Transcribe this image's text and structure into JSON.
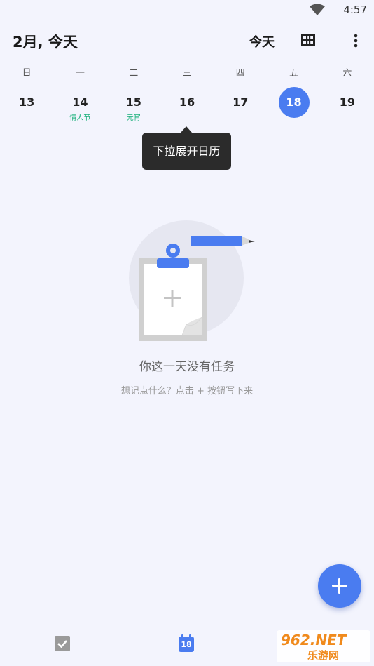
{
  "status_bar": {
    "time": "4:57",
    "wifi_icon": "wifi-icon"
  },
  "header": {
    "title": "2月, 今天",
    "today_label": "今天",
    "view_icon": "calendar-view-icon",
    "more_icon": "more-vert-icon"
  },
  "week": {
    "weekdays": [
      "日",
      "一",
      "二",
      "三",
      "四",
      "五",
      "六"
    ],
    "dates": [
      {
        "day": "13",
        "festival": ""
      },
      {
        "day": "14",
        "festival": "情人节"
      },
      {
        "day": "15",
        "festival": "元宵"
      },
      {
        "day": "16",
        "festival": ""
      },
      {
        "day": "17",
        "festival": ""
      },
      {
        "day": "18",
        "festival": ""
      },
      {
        "day": "19",
        "festival": ""
      }
    ],
    "selected_index": 5
  },
  "tooltip": {
    "text": "下拉展开日历"
  },
  "empty_state": {
    "title": "你这一天没有任务",
    "hint": "想记点什么？点击 + 按钮写下来",
    "illustration_icon": "clipboard-pencil-illustration"
  },
  "fab": {
    "icon": "plus-icon"
  },
  "bottom_nav": {
    "tasks_icon": "checkbox-icon",
    "calendar_icon": "calendar-icon",
    "calendar_day": "18"
  },
  "watermark": {
    "text_top": "962.NET",
    "text_bottom": "乐游网"
  },
  "colors": {
    "accent": "#4a7cf0",
    "festival": "#19b07a",
    "background": "#f3f4fd"
  }
}
